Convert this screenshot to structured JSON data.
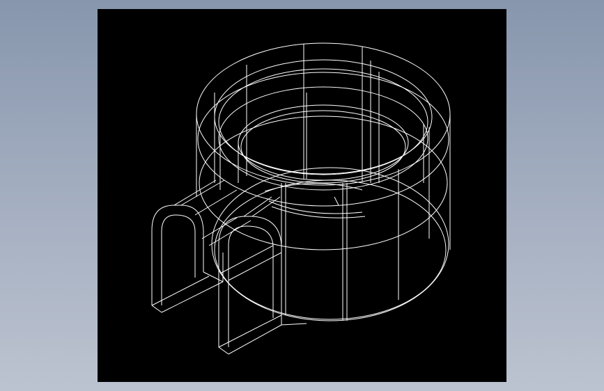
{
  "viewport": {
    "background_color": "#000000",
    "wireframe_color": "#ffffff",
    "app_background_top": "#8796ad",
    "app_background_bottom": "#bcc3d0",
    "view_style": "wireframe",
    "model": {
      "description_icon": "isometric-wireframe-model-icon"
    }
  }
}
